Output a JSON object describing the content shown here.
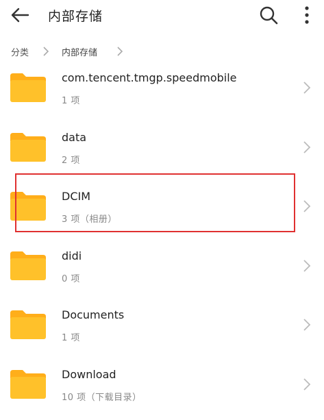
{
  "header": {
    "title": "内部存储",
    "back_icon": "back-arrow-icon",
    "search_icon": "search-icon",
    "more_icon": "more-vertical-icon"
  },
  "breadcrumb": {
    "root": "分类",
    "current": "内部存储"
  },
  "colors": {
    "folder": "#FFC12A",
    "folder_tab": "#FFAE1A",
    "highlight": "#e03030"
  },
  "folders": [
    {
      "name": "com.tencent.tmgp.speedmobile",
      "meta": "1 项"
    },
    {
      "name": "data",
      "meta": "2 项"
    },
    {
      "name": "DCIM",
      "meta": "3 项（相册）"
    },
    {
      "name": "didi",
      "meta": "0 项"
    },
    {
      "name": "Documents",
      "meta": "1 项"
    },
    {
      "name": "Download",
      "meta": "10 项（下载目录）"
    }
  ]
}
